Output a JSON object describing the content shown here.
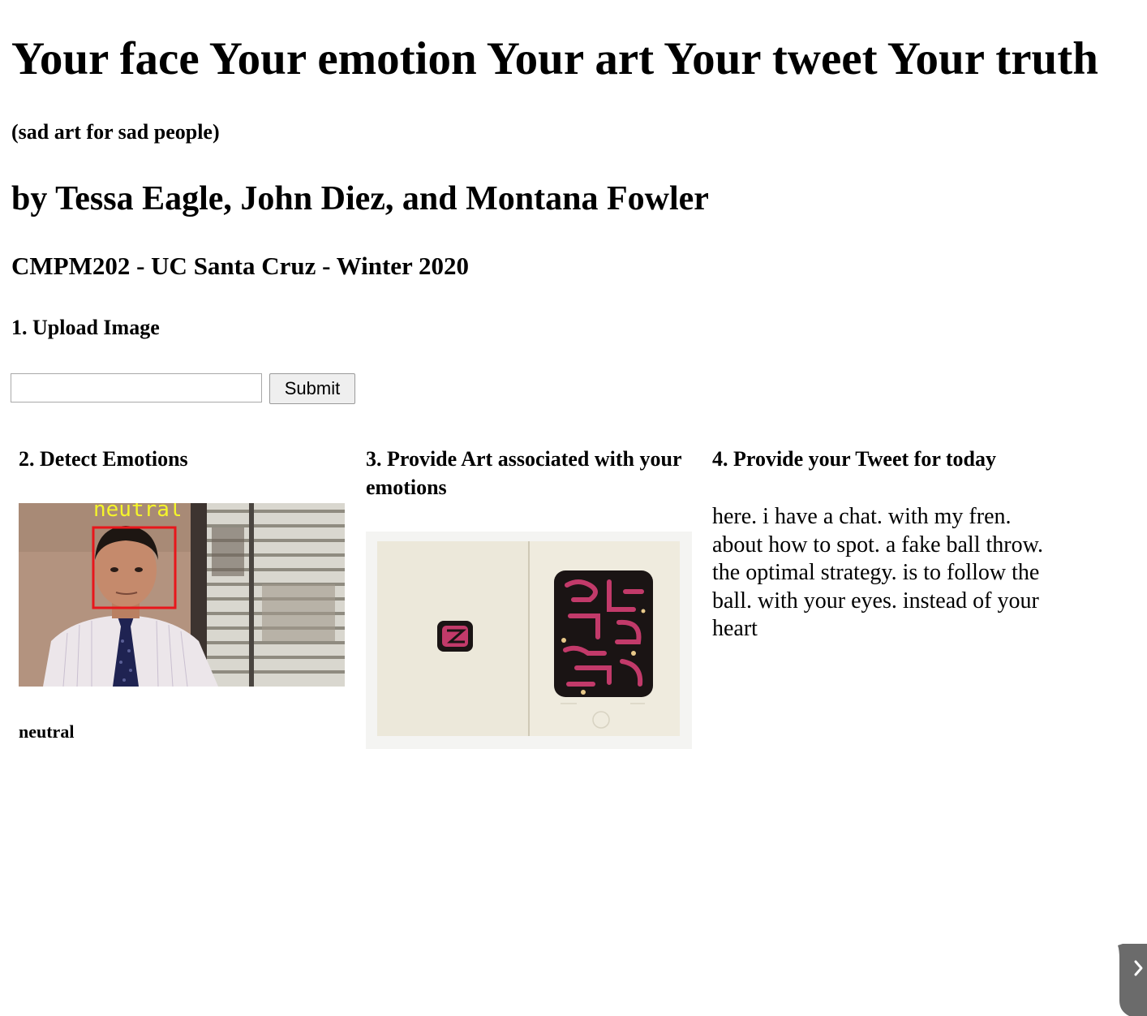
{
  "header": {
    "title": "Your face Your emotion Your art Your tweet Your truth",
    "subtitle": "(sad art for sad people)",
    "authors": "by Tessa Eagle, John Diez, and Montana Fowler",
    "course": "CMPM202 - UC Santa Cruz - Winter 2020"
  },
  "upload": {
    "heading": "1. Upload Image",
    "input_value": "",
    "submit_label": "Submit"
  },
  "detect": {
    "heading": "2. Detect Emotions",
    "photo_overlay_label": "neutral",
    "emotion_result": "neutral"
  },
  "art": {
    "heading": "3. Provide Art associated with your emotions"
  },
  "tweet": {
    "heading": "4. Provide your Tweet for today",
    "text": "here. i have a chat. with my fren. about how to spot. a fake ball throw. the optimal strategy. is to follow the ball. with your eyes. instead of your heart"
  },
  "icons": {
    "side_toggle": "chevron-right-icon"
  },
  "colors": {
    "face_box": "#e8161b",
    "overlay_label": "#f5f52a",
    "art_magenta": "#c23a6a"
  }
}
